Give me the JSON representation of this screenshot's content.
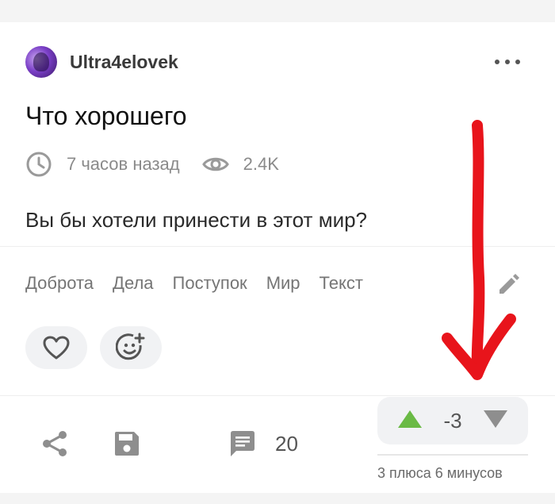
{
  "post": {
    "author": "Ultra4elovek",
    "title": "Что хорошего",
    "time_ago": "7 часов назад",
    "views": "2.4K",
    "body": "Вы бы хотели принести в этот мир?",
    "tags": [
      "Доброта",
      "Дела",
      "Поступок",
      "Мир",
      "Текст"
    ]
  },
  "footer": {
    "comments_count": "20",
    "rating": "-3",
    "rating_summary": "3 плюса 6 минусов"
  },
  "colors": {
    "upvote": "#6aba45",
    "downvote": "#8e8e8e",
    "annotation_arrow": "#e8141b"
  }
}
